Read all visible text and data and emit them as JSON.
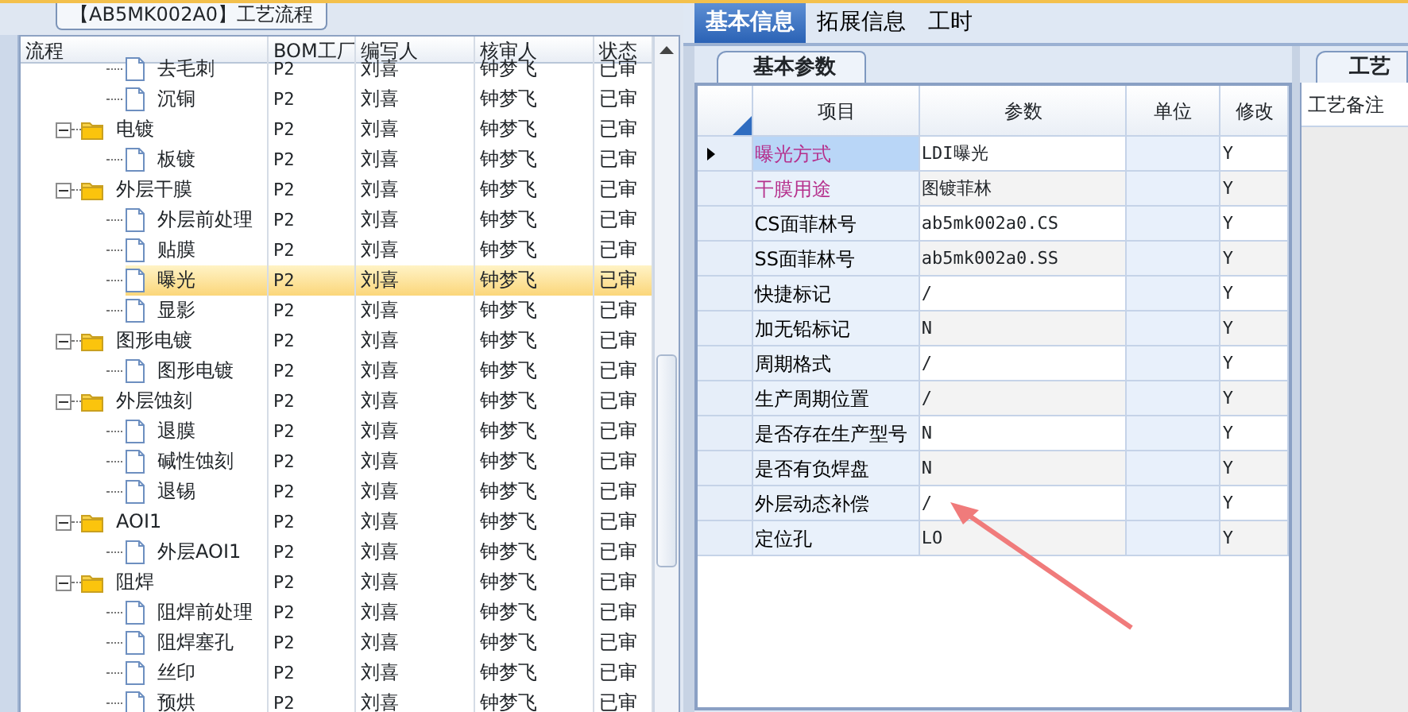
{
  "group_title": "【AB5MK002A0】工艺流程",
  "tree": {
    "columns": [
      "流程",
      "BOM工厂",
      "编写人",
      "核审人",
      "状态"
    ],
    "continued_children": [
      {
        "label": "去毛刺",
        "kind": "file",
        "bom": "P2",
        "writer": "刘喜",
        "reviewer": "钟梦飞",
        "status": "已审",
        "selected": false
      },
      {
        "label": "沉铜",
        "kind": "file",
        "bom": "P2",
        "writer": "刘喜",
        "reviewer": "钟梦飞",
        "status": "已审",
        "selected": false
      }
    ],
    "items": [
      {
        "label": "电镀",
        "kind": "folder",
        "expanded": true,
        "bom": "P2",
        "writer": "刘喜",
        "reviewer": "钟梦飞",
        "status": "已审",
        "selected": false,
        "children": [
          {
            "label": "板镀",
            "kind": "file",
            "bom": "P2",
            "writer": "刘喜",
            "reviewer": "钟梦飞",
            "status": "已审",
            "selected": false
          }
        ]
      },
      {
        "label": "外层干膜",
        "kind": "folder",
        "expanded": true,
        "bom": "P2",
        "writer": "刘喜",
        "reviewer": "钟梦飞",
        "status": "已审",
        "selected": false,
        "children": [
          {
            "label": "外层前处理",
            "kind": "file",
            "bom": "P2",
            "writer": "刘喜",
            "reviewer": "钟梦飞",
            "status": "已审",
            "selected": false
          },
          {
            "label": "贴膜",
            "kind": "file",
            "bom": "P2",
            "writer": "刘喜",
            "reviewer": "钟梦飞",
            "status": "已审",
            "selected": false
          },
          {
            "label": "曝光",
            "kind": "file",
            "bom": "P2",
            "writer": "刘喜",
            "reviewer": "钟梦飞",
            "status": "已审",
            "selected": true
          },
          {
            "label": "显影",
            "kind": "file",
            "bom": "P2",
            "writer": "刘喜",
            "reviewer": "钟梦飞",
            "status": "已审",
            "selected": false
          }
        ]
      },
      {
        "label": "图形电镀",
        "kind": "folder",
        "expanded": true,
        "bom": "P2",
        "writer": "刘喜",
        "reviewer": "钟梦飞",
        "status": "已审",
        "selected": false,
        "children": [
          {
            "label": "图形电镀",
            "kind": "file",
            "bom": "P2",
            "writer": "刘喜",
            "reviewer": "钟梦飞",
            "status": "已审",
            "selected": false
          }
        ]
      },
      {
        "label": "外层蚀刻",
        "kind": "folder",
        "expanded": true,
        "bom": "P2",
        "writer": "刘喜",
        "reviewer": "钟梦飞",
        "status": "已审",
        "selected": false,
        "children": [
          {
            "label": "退膜",
            "kind": "file",
            "bom": "P2",
            "writer": "刘喜",
            "reviewer": "钟梦飞",
            "status": "已审",
            "selected": false
          },
          {
            "label": "碱性蚀刻",
            "kind": "file",
            "bom": "P2",
            "writer": "刘喜",
            "reviewer": "钟梦飞",
            "status": "已审",
            "selected": false
          },
          {
            "label": "退锡",
            "kind": "file",
            "bom": "P2",
            "writer": "刘喜",
            "reviewer": "钟梦飞",
            "status": "已审",
            "selected": false
          }
        ]
      },
      {
        "label": "AOI1",
        "kind": "folder",
        "expanded": true,
        "bom": "P2",
        "writer": "刘喜",
        "reviewer": "钟梦飞",
        "status": "已审",
        "selected": false,
        "children": [
          {
            "label": "外层AOI1",
            "kind": "file",
            "bom": "P2",
            "writer": "刘喜",
            "reviewer": "钟梦飞",
            "status": "已审",
            "selected": false
          }
        ]
      },
      {
        "label": "阻焊",
        "kind": "folder",
        "expanded": true,
        "bom": "P2",
        "writer": "刘喜",
        "reviewer": "钟梦飞",
        "status": "已审",
        "selected": false,
        "children": [
          {
            "label": "阻焊前处理",
            "kind": "file",
            "bom": "P2",
            "writer": "刘喜",
            "reviewer": "钟梦飞",
            "status": "已审",
            "selected": false
          },
          {
            "label": "阻焊塞孔",
            "kind": "file",
            "bom": "P2",
            "writer": "刘喜",
            "reviewer": "钟梦飞",
            "status": "已审",
            "selected": false
          },
          {
            "label": "丝印",
            "kind": "file",
            "bom": "P2",
            "writer": "刘喜",
            "reviewer": "钟梦飞",
            "status": "已审",
            "selected": false
          },
          {
            "label": "预烘",
            "kind": "file",
            "bom": "P2",
            "writer": "刘喜",
            "reviewer": "钟梦飞",
            "status": "已审",
            "selected": false
          }
        ]
      }
    ]
  },
  "tabs": [
    {
      "label": "基本信息",
      "selected": true
    },
    {
      "label": "拓展信息",
      "selected": false
    },
    {
      "label": "工时",
      "selected": false
    }
  ],
  "sub_tab": "基本参数",
  "params": {
    "columns": [
      "项目",
      "参数",
      "单位",
      "修改"
    ],
    "rows": [
      {
        "item": "曝光方式",
        "color": "#b52f8c",
        "value": "LDI曝光",
        "modified": "Y",
        "selected": true
      },
      {
        "item": "干膜用途",
        "color": "#b52f8c",
        "value": "图镀菲林",
        "modified": "Y",
        "selected": false
      },
      {
        "item": "CS面菲林号",
        "color": "#000000",
        "value": "ab5mk002a0.CS",
        "modified": "Y",
        "selected": false
      },
      {
        "item": "SS面菲林号",
        "color": "#000000",
        "value": "ab5mk002a0.SS",
        "modified": "Y",
        "selected": false
      },
      {
        "item": "快捷标记",
        "color": "#000000",
        "value": "/",
        "modified": "Y",
        "selected": false
      },
      {
        "item": "加无铅标记",
        "color": "#000000",
        "value": "N",
        "modified": "Y",
        "selected": false
      },
      {
        "item": "周期格式",
        "color": "#000000",
        "value": "/",
        "modified": "Y",
        "selected": false
      },
      {
        "item": "生产周期位置",
        "color": "#000000",
        "value": "/",
        "modified": "Y",
        "selected": false
      },
      {
        "item": "是否存在生产型号",
        "color": "#000000",
        "value": "N",
        "modified": "Y",
        "selected": false
      },
      {
        "item": "是否有负焊盘",
        "color": "#000000",
        "value": "N",
        "modified": "Y",
        "selected": false
      },
      {
        "item": "外层动态补偿",
        "color": "#000000",
        "value": "/",
        "modified": "Y",
        "selected": false
      },
      {
        "item": "定位孔",
        "color": "#000000",
        "value": "LO",
        "modified": "Y",
        "selected": false
      }
    ]
  },
  "side_panel": {
    "tab": "工艺",
    "header": "工艺备注"
  }
}
